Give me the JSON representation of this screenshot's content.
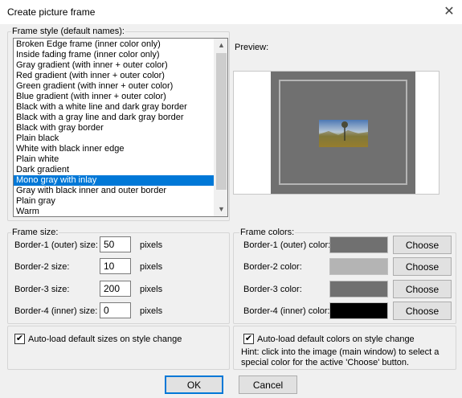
{
  "window": {
    "title": "Create picture frame",
    "close_glyph": "✕"
  },
  "frame_style": {
    "label": "Frame style (default names):",
    "items": [
      "Broken Edge frame (inner color only)",
      "Inside fading frame (inner color only)",
      "Gray gradient (with inner + outer color)",
      "Red gradient (with inner + outer color)",
      "Green gradient (with inner + outer color)",
      "Blue gradient (with inner + outer color)",
      "Black with a white line and dark gray border",
      "Black with a gray line and dark gray border",
      "Black with gray border",
      "Plain black",
      "White with black inner edge",
      "Plain white",
      "Dark gradient",
      "Mono gray with inlay",
      "Gray with black inner and outer border",
      "Plain gray",
      "Warm"
    ],
    "selected_item": "Mono gray with inlay"
  },
  "preview": {
    "label": "Preview:"
  },
  "frame_size": {
    "label": "Frame size:",
    "rows": [
      {
        "label": "Border-1 (outer) size:",
        "value": "50",
        "unit": "pixels"
      },
      {
        "label": "Border-2 size:",
        "value": "10",
        "unit": "pixels"
      },
      {
        "label": "Border-3 size:",
        "value": "200",
        "unit": "pixels"
      },
      {
        "label": "Border-4 (inner) size:",
        "value": "0",
        "unit": "pixels"
      }
    ],
    "autoload_label": "Auto-load default sizes on style change",
    "autoload_checked": true
  },
  "frame_colors": {
    "label": "Frame colors:",
    "rows": [
      {
        "label": "Border-1 (outer) color:",
        "color": "#707070",
        "button": "Choose"
      },
      {
        "label": "Border-2 color:",
        "color": "#b4b4b4",
        "button": "Choose"
      },
      {
        "label": "Border-3 color:",
        "color": "#707070",
        "button": "Choose"
      },
      {
        "label": "Border-4 (inner) color:",
        "color": "#000000",
        "button": "Choose"
      }
    ],
    "autoload_label": "Auto-load default colors on style change",
    "autoload_checked": true,
    "hint": "Hint: click into the image (main window) to select a special color for the active 'Choose' button."
  },
  "buttons": {
    "ok": "OK",
    "cancel": "Cancel"
  },
  "icons": {
    "checkmark": "✔",
    "scroll_up": "▲",
    "scroll_down": "▼"
  }
}
